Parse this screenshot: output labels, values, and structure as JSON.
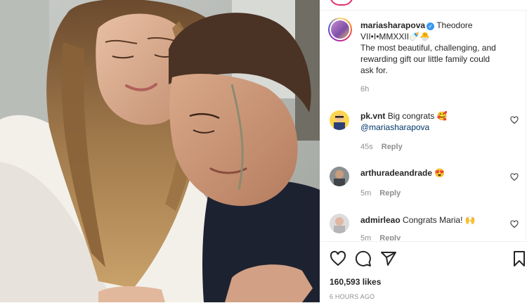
{
  "post": {
    "username": "mariasharapova",
    "caption_title": "Theodore",
    "caption_line2": "VII•I•MMXXII",
    "caption_emojis": "🍼🐣",
    "caption_body": "The most beautiful, challenging, and rewarding gift our little family could ask for.",
    "age": "6h"
  },
  "comments": [
    {
      "username": "pk.vnt",
      "text": "Big congrats 🥰",
      "mention": "@mariasharapova",
      "age": "45s",
      "reply": "Reply"
    },
    {
      "username": "arthuradeandrade",
      "text": "😍",
      "age": "5m",
      "reply": "Reply"
    },
    {
      "username": "admirleao",
      "text": "Congrats Maria! 🙌",
      "age": "5m",
      "reply": "Reply"
    }
  ],
  "footer": {
    "likes": "160,593 likes",
    "timestamp": "6 HOURS AGO"
  },
  "icons": {
    "like": "heart-icon",
    "comment": "comment-icon",
    "share": "share-icon",
    "save": "bookmark-icon",
    "verified": "verified-badge-icon"
  },
  "colors": {
    "text": "#262626",
    "muted": "#8e8e8e",
    "mention": "#00376b",
    "verified": "#3897f0"
  }
}
